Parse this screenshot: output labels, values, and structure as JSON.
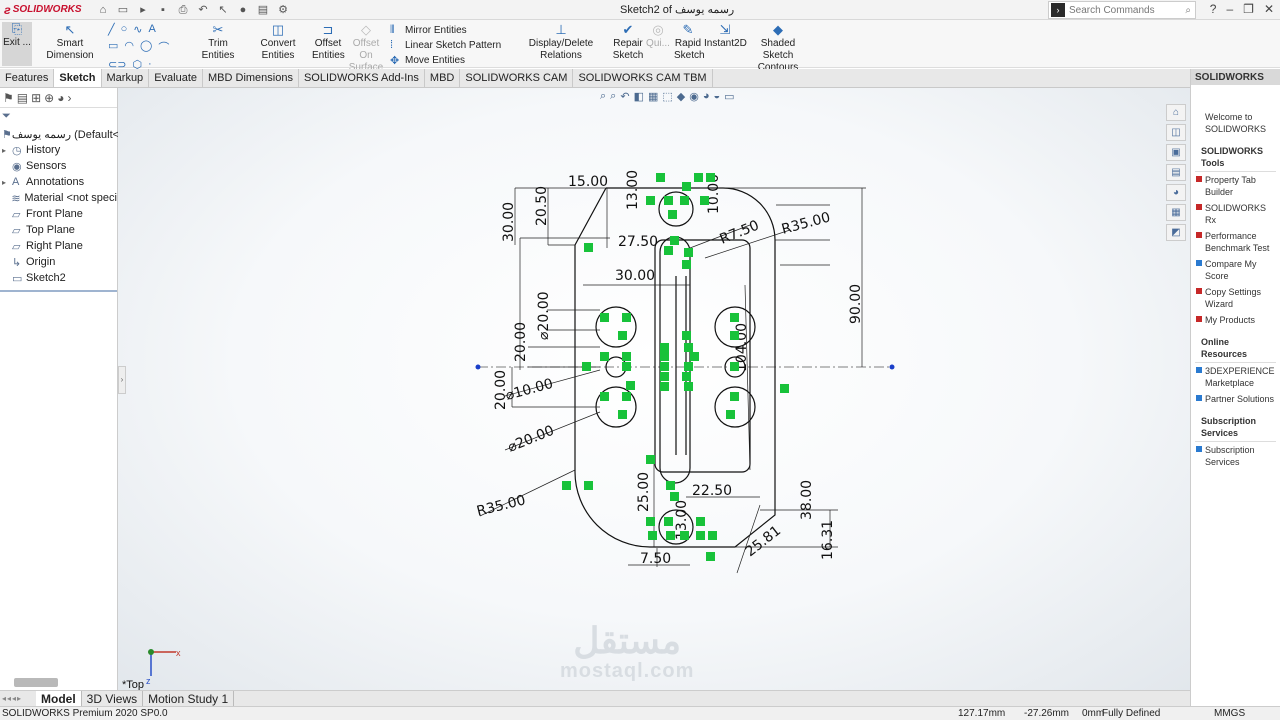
{
  "app": {
    "brand": "SOLIDWORKS",
    "doc_title": "Sketch2 of رسمه يوسف"
  },
  "search": {
    "placeholder": "Search Commands"
  },
  "ribbon": {
    "exit": "Exit ...",
    "smart_dimension": "Smart Dimension",
    "trim": "Trim Entities",
    "convert": "Convert Entities",
    "offset_line1": "Offset",
    "offset_line2": "Entities",
    "offset_surface_line1": "Offset On",
    "offset_surface_line2": "Surface",
    "mirror": "Mirror Entities",
    "linear_pattern": "Linear Sketch Pattern",
    "move": "Move Entities",
    "display_delete": "Display/Delete Relations",
    "repair_line1": "Repair",
    "repair_line2": "Sketch",
    "quick": "Qui...",
    "rapid_line1": "Rapid",
    "rapid_line2": "Sketch",
    "instant2d": "Instant2D",
    "shaded_line1": "Shaded Sketch",
    "shaded_line2": "Contours"
  },
  "tabs": [
    "Features",
    "Sketch",
    "Markup",
    "Evaluate",
    "MBD Dimensions",
    "SOLIDWORKS Add-Ins",
    "MBD",
    "SOLIDWORKS CAM",
    "SOLIDWORKS CAM TBM"
  ],
  "tree": {
    "root": "رسمه يوسف  (Default<",
    "items": [
      "History",
      "Sensors",
      "Annotations",
      "Material <not speci",
      "Front Plane",
      "Top Plane",
      "Right Plane",
      "Origin",
      "Sketch2"
    ]
  },
  "dims": {
    "d15": "15.00",
    "d20_50": "20.50",
    "d30_top": "30.00",
    "d13": "13.00",
    "d10": "10.00",
    "d27_50": "27.50",
    "r7_50": "R7.50",
    "r35_top": "R35.00",
    "d30_inner": "30.00",
    "d90": "90.00",
    "dia20_a": "⌀20.00",
    "d20_mid": "20.00",
    "dia10": "⌀10.00",
    "d20_low": "20.00",
    "dia20_b": "⌀20.00",
    "d104": "104.00",
    "r35_bot": "R35.00",
    "d25": "25.00",
    "d22_50": "22.50",
    "d13_b": "13.00",
    "d38": "38.00",
    "d25_81": "25.81",
    "d16_31": "16.31",
    "d7_50": "7.50"
  },
  "view_label": "*Top",
  "bottom_tabs": [
    "Model",
    "3D Views",
    "Motion Study 1"
  ],
  "status": {
    "edition": "SOLIDWORKS Premium 2020 SP0.0",
    "x": "127.17mm",
    "y": "-27.26mm",
    "z": "0mm",
    "state": "Fully Defined",
    "units": "MMGS"
  },
  "taskpane": {
    "title": "SOLIDWORKS",
    "welcome": "Welcome to SOLIDWORKS",
    "tools_title": "SOLIDWORKS Tools",
    "tools": [
      "Property Tab Builder",
      "SOLIDWORKS Rx",
      "Performance Benchmark Test",
      "Compare My Score",
      "Copy Settings Wizard",
      "My Products"
    ],
    "online_title": "Online Resources",
    "online": [
      "3DEXPERIENCE Marketplace",
      "Partner Solutions"
    ],
    "sub_title": "Subscription Services",
    "sub": [
      "Subscription Services"
    ]
  },
  "watermark": {
    "arabic": "مستقل",
    "latin": "mostaql.com"
  }
}
